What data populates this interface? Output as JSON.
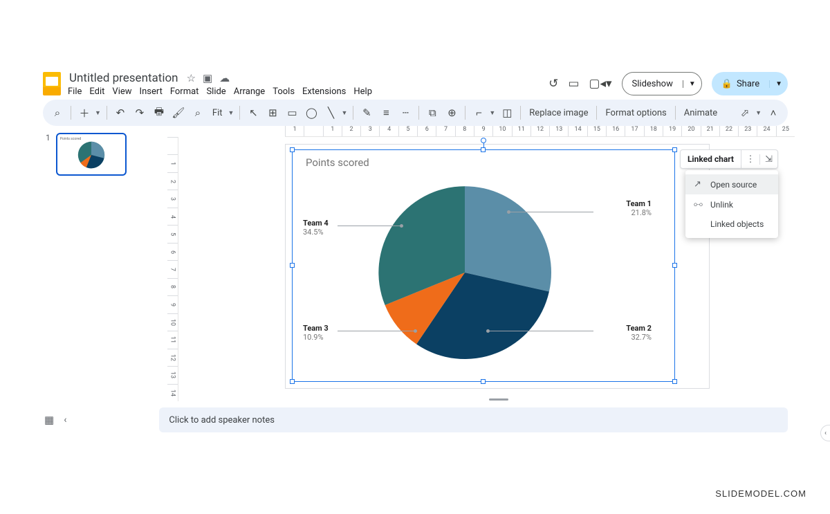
{
  "doc": {
    "title": "Untitled presentation"
  },
  "menus": [
    "File",
    "Edit",
    "View",
    "Insert",
    "Format",
    "Slide",
    "Arrange",
    "Tools",
    "Extensions",
    "Help"
  ],
  "header": {
    "slideshow": "Slideshow",
    "share": "Share"
  },
  "toolbar": {
    "zoom": "Fit",
    "replace_image": "Replace image",
    "format_options": "Format options",
    "animate": "Animate"
  },
  "ruler_h": [
    "1",
    "",
    "1",
    "2",
    "3",
    "4",
    "5",
    "6",
    "7",
    "8",
    "9",
    "10",
    "11",
    "12",
    "13",
    "14",
    "15",
    "16",
    "17",
    "18",
    "19",
    "20",
    "21",
    "22",
    "23",
    "24",
    "25"
  ],
  "ruler_v": [
    "",
    "1",
    "2",
    "3",
    "4",
    "5",
    "6",
    "7",
    "8",
    "9",
    "10",
    "11",
    "12",
    "13",
    "14"
  ],
  "thumb": {
    "num": "1"
  },
  "chart": {
    "title": "Points scored"
  },
  "linked": {
    "label": "Linked chart",
    "menu": {
      "open_source": "Open source",
      "unlink": "Unlink",
      "linked_objects": "Linked objects"
    }
  },
  "labels": {
    "team1": {
      "name": "Team 1",
      "pct": "21.8%"
    },
    "team2": {
      "name": "Team 2",
      "pct": "32.7%"
    },
    "team3": {
      "name": "Team 3",
      "pct": "10.9%"
    },
    "team4": {
      "name": "Team 4",
      "pct": "34.5%"
    }
  },
  "notes": {
    "placeholder": "Click to add speaker notes"
  },
  "watermark": "SLIDEMODEL.COM",
  "chart_data": {
    "type": "pie",
    "title": "Points scored",
    "categories": [
      "Team 1",
      "Team 2",
      "Team 3",
      "Team 4"
    ],
    "values": [
      21.8,
      32.7,
      10.9,
      34.5
    ],
    "colors": [
      "#5b8ea8",
      "#0b4063",
      "#ef6c1a",
      "#2c7373"
    ]
  }
}
